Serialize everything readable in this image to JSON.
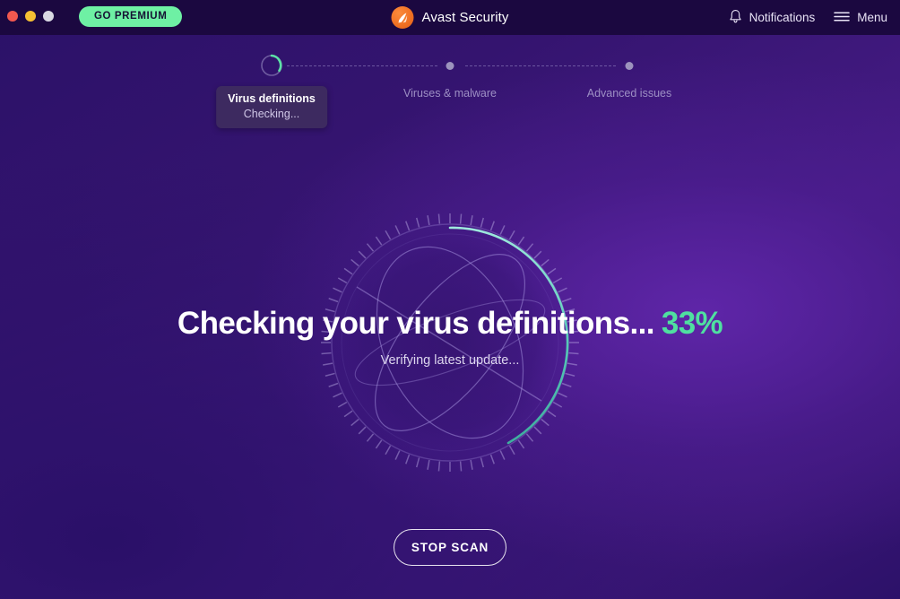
{
  "window": {
    "traffic_lights": [
      {
        "name": "close",
        "color": "#f2584f"
      },
      {
        "name": "minimize",
        "color": "#f6c033"
      },
      {
        "name": "zoom",
        "color": "#d9d9e2"
      }
    ]
  },
  "header": {
    "go_premium_label": "GO PREMIUM",
    "brand_name": "Avast Security",
    "brand_logo_icon": "avast-logo-icon",
    "notifications_label": "Notifications",
    "notifications_icon": "bell-icon",
    "menu_label": "Menu",
    "menu_icon": "hamburger-icon",
    "accent_green": "#6ef0a4",
    "logo_orange": "#ef6f22"
  },
  "stepper": {
    "steps": [
      {
        "label": "Virus definitions",
        "state": "active",
        "icon": "spinner-icon",
        "tooltip_title": "Virus definitions",
        "tooltip_status": "Checking..."
      },
      {
        "label": "Viruses & malware",
        "state": "pending",
        "icon": "dot-icon"
      },
      {
        "label": "Advanced issues",
        "state": "pending",
        "icon": "dot-icon"
      }
    ]
  },
  "scan": {
    "headline": "Checking your virus definitions...",
    "percent_label": "33%",
    "percent_value": 33,
    "subline": "Verifying latest update...",
    "graphic_icon": "scan-radar-icon",
    "progress_color": "#4fe0a0",
    "arc_color": "#5fd9c0"
  },
  "actions": {
    "stop_scan_label": "STOP SCAN"
  }
}
